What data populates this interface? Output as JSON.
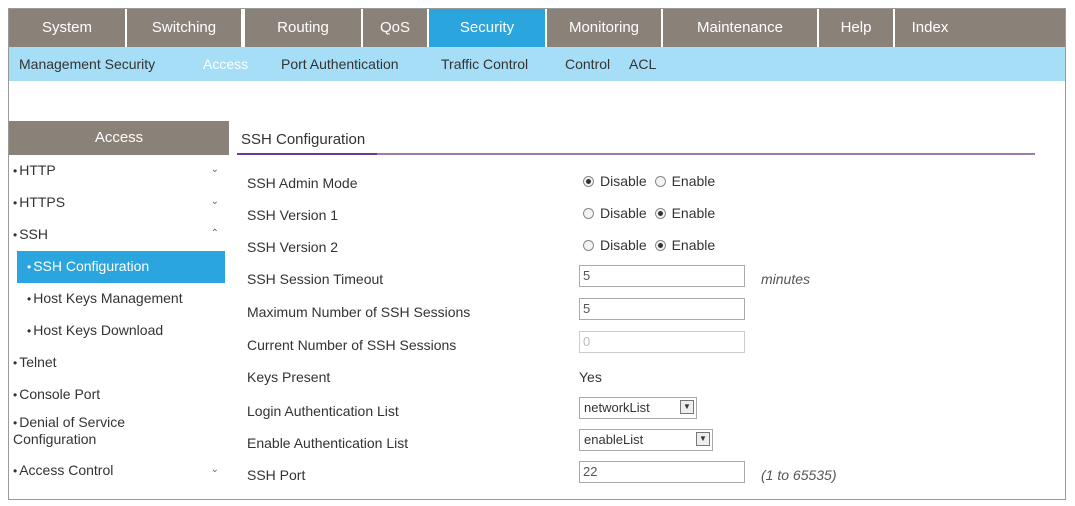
{
  "topnav": {
    "tabs": [
      {
        "label": "System"
      },
      {
        "label": "Switching"
      },
      {
        "label": "Routing"
      },
      {
        "label": "QoS"
      },
      {
        "label": "Security"
      },
      {
        "label": "Monitoring"
      },
      {
        "label": "Maintenance"
      },
      {
        "label": "Help"
      },
      {
        "label": "Index"
      }
    ],
    "active": "Security"
  },
  "subnav": {
    "items": [
      {
        "label": "Management Security"
      },
      {
        "label": "Access"
      },
      {
        "label": "Port Authentication"
      },
      {
        "label": "Traffic Control"
      },
      {
        "label": "Control"
      },
      {
        "label": "ACL"
      }
    ],
    "active": "Access"
  },
  "sidebar": {
    "title": "Access",
    "items": [
      {
        "label": "HTTP",
        "chevron": "⌄"
      },
      {
        "label": "HTTPS",
        "chevron": "⌄"
      },
      {
        "label": "SSH",
        "chevron": "⌃"
      },
      {
        "label": "SSH Configuration"
      },
      {
        "label": "Host Keys Management"
      },
      {
        "label": "Host Keys Download"
      },
      {
        "label": "Telnet"
      },
      {
        "label": "Console Port"
      },
      {
        "label": "Denial of Service",
        "label2": "Configuration"
      },
      {
        "label": "Access Control",
        "chevron": "⌄"
      }
    ],
    "selected": "SSH Configuration"
  },
  "main": {
    "title": "SSH Configuration",
    "fields": {
      "admin_mode": {
        "label": "SSH Admin Mode",
        "opt1": "Disable",
        "opt2": "Enable",
        "selected": "Disable"
      },
      "version1": {
        "label": "SSH Version 1",
        "opt1": "Disable",
        "opt2": "Enable",
        "selected": "Enable"
      },
      "version2": {
        "label": "SSH Version 2",
        "opt1": "Disable",
        "opt2": "Enable",
        "selected": "Enable"
      },
      "timeout": {
        "label": "SSH Session Timeout",
        "value": "5",
        "unit": "minutes"
      },
      "max_sessions": {
        "label": "Maximum Number of SSH Sessions",
        "value": "5"
      },
      "current_sessions": {
        "label": "Current Number of SSH Sessions",
        "value": "0"
      },
      "keys_present": {
        "label": "Keys Present",
        "value": "Yes"
      },
      "login_auth": {
        "label": "Login Authentication List",
        "value": "networkList"
      },
      "enable_auth": {
        "label": "Enable Authentication List",
        "value": "enableList"
      },
      "port": {
        "label": "SSH Port",
        "value": "22",
        "range": "(1 to 65535)"
      }
    }
  },
  "colors": {
    "nav_bg": "#8a8278",
    "active_tab": "#2aa5dd",
    "subnav_bg": "#a5def6",
    "title_underline": "#6a3d93"
  }
}
